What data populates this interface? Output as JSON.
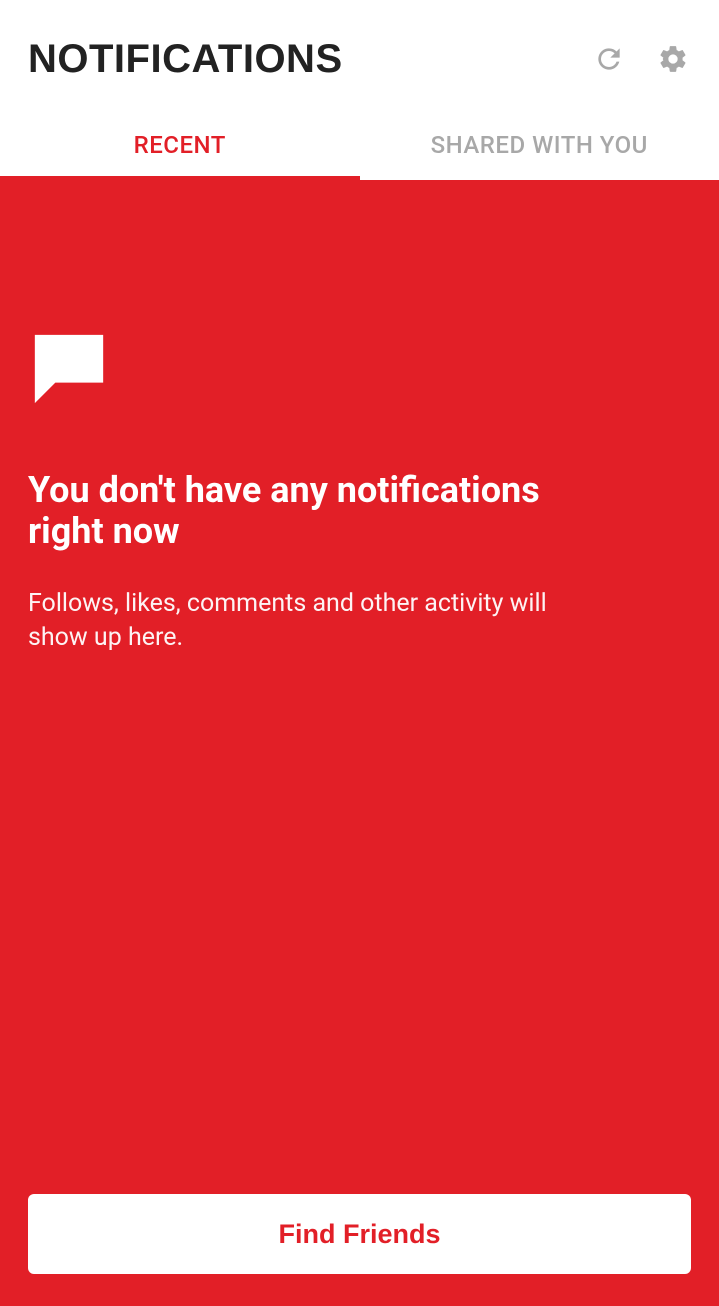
{
  "header": {
    "title": "NOTIFICATIONS"
  },
  "tabs": {
    "recent": "RECENT",
    "shared": "SHARED WITH YOU"
  },
  "empty": {
    "title": "You don't have any notifications right now",
    "desc": "Follows, likes, comments and other activity will show up here."
  },
  "actions": {
    "find_friends": "Find Friends"
  },
  "colors": {
    "accent": "#e21f27"
  }
}
